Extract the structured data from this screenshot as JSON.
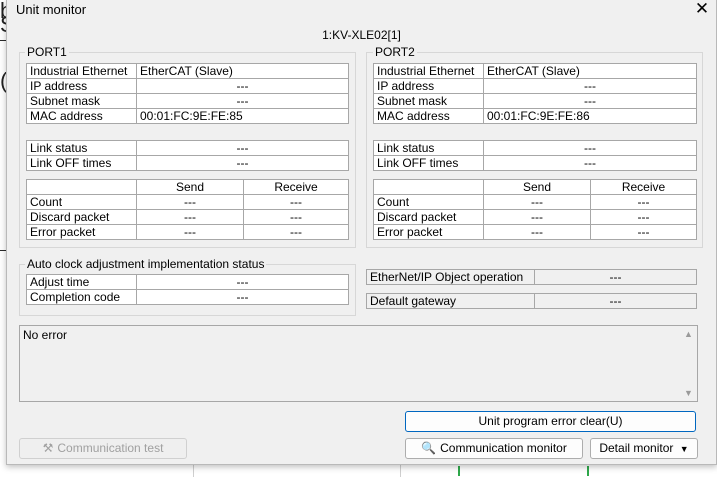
{
  "window": {
    "title": "Unit monitor",
    "close_symbol": "✕",
    "unit_name": "1:KV-XLE02[1]"
  },
  "port1": {
    "label": "PORT1",
    "info": [
      {
        "name": "Industrial Ethernet",
        "value": "EtherCAT (Slave)"
      },
      {
        "name": "IP address",
        "value": "---"
      },
      {
        "name": "Subnet mask",
        "value": "---"
      },
      {
        "name": "MAC address",
        "value": "00:01:FC:9E:FE:85"
      }
    ],
    "link": [
      {
        "name": "Link status",
        "value": "---"
      },
      {
        "name": "Link OFF times",
        "value": "---"
      }
    ],
    "counters_header": {
      "send": "Send",
      "receive": "Receive"
    },
    "counters": [
      {
        "name": "Count",
        "send": "---",
        "receive": "---"
      },
      {
        "name": "Discard packet",
        "send": "---",
        "receive": "---"
      },
      {
        "name": "Error packet",
        "send": "---",
        "receive": "---"
      }
    ]
  },
  "port2": {
    "label": "PORT2",
    "info": [
      {
        "name": "Industrial Ethernet",
        "value": "EtherCAT (Slave)"
      },
      {
        "name": "IP address",
        "value": "---"
      },
      {
        "name": "Subnet mask",
        "value": "---"
      },
      {
        "name": "MAC address",
        "value": "00:01:FC:9E:FE:86"
      }
    ],
    "link": [
      {
        "name": "Link status",
        "value": "---"
      },
      {
        "name": "Link OFF times",
        "value": "---"
      }
    ],
    "counters_header": {
      "send": "Send",
      "receive": "Receive"
    },
    "counters": [
      {
        "name": "Count",
        "send": "---",
        "receive": "---"
      },
      {
        "name": "Discard packet",
        "send": "---",
        "receive": "---"
      },
      {
        "name": "Error packet",
        "send": "---",
        "receive": "---"
      }
    ]
  },
  "auto_clock": {
    "label": "Auto clock adjustment implementation status",
    "rows": [
      {
        "name": "Adjust time",
        "value": "---"
      },
      {
        "name": "Completion code",
        "value": "---"
      }
    ]
  },
  "ethernet_ip": {
    "name": "EtherNet/IP Object operation",
    "value": "---"
  },
  "gateway": {
    "name": "Default gateway",
    "value": "---"
  },
  "error_box": {
    "text": "No error"
  },
  "buttons": {
    "error_clear": "Unit program error clear(U)",
    "comm_test": "Communication test",
    "comm_monitor": "Communication monitor",
    "detail_monitor": "Detail monitor"
  },
  "icons": {
    "comm_test": "test-tool-icon",
    "comm_monitor": "monitor-search-icon",
    "detail_dropdown": "caret-down-icon"
  },
  "colors": {
    "dialog_bg": "#f0f0f0",
    "primary_border": "#0067c0",
    "disabled_text": "#a0a0a0"
  }
}
